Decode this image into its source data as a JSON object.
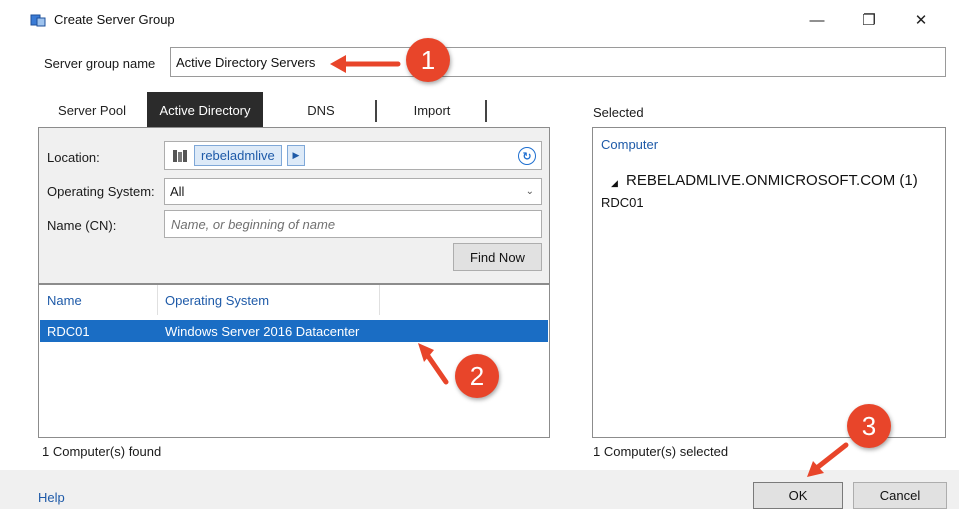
{
  "window": {
    "title": "Create Server Group",
    "minimize_glyph": "—",
    "maximize_glyph": "❐",
    "close_glyph": "✕"
  },
  "server_group": {
    "label": "Server group name",
    "value": "Active Directory Servers"
  },
  "tabs": [
    {
      "label": "Server Pool",
      "active": false
    },
    {
      "label": "Active Directory",
      "active": true
    },
    {
      "label": "DNS",
      "active": false
    },
    {
      "label": "Import",
      "active": false
    }
  ],
  "search": {
    "location_label": "Location:",
    "location_value": "rebeladmlive",
    "os_label": "Operating System:",
    "os_value": "All",
    "name_label": "Name (CN):",
    "name_placeholder": "Name, or beginning of name",
    "find_button": "Find Now"
  },
  "results": {
    "columns": [
      "Name",
      "Operating System"
    ],
    "rows": [
      {
        "name": "RDC01",
        "os": "Windows Server 2016 Datacenter",
        "selected": true
      }
    ],
    "footer": "1 Computer(s) found"
  },
  "selected": {
    "label": "Selected",
    "column": "Computer",
    "domain": "REBELADMLIVE.ONMICROSOFT.COM (1)",
    "items": [
      "RDC01"
    ],
    "footer": "1 Computer(s) selected"
  },
  "bottom": {
    "help": "Help",
    "ok": "OK",
    "cancel": "Cancel"
  },
  "callouts": [
    "1",
    "2",
    "3"
  ],
  "colors": {
    "accent_blue": "#1e5aa8",
    "selection_blue": "#1a6dc4",
    "active_tab": "#2b2b2b",
    "callout_red": "#e8452a"
  },
  "icons": {
    "app": "server-manager-icon",
    "location": "domain-icon",
    "refresh": "refresh-icon"
  }
}
